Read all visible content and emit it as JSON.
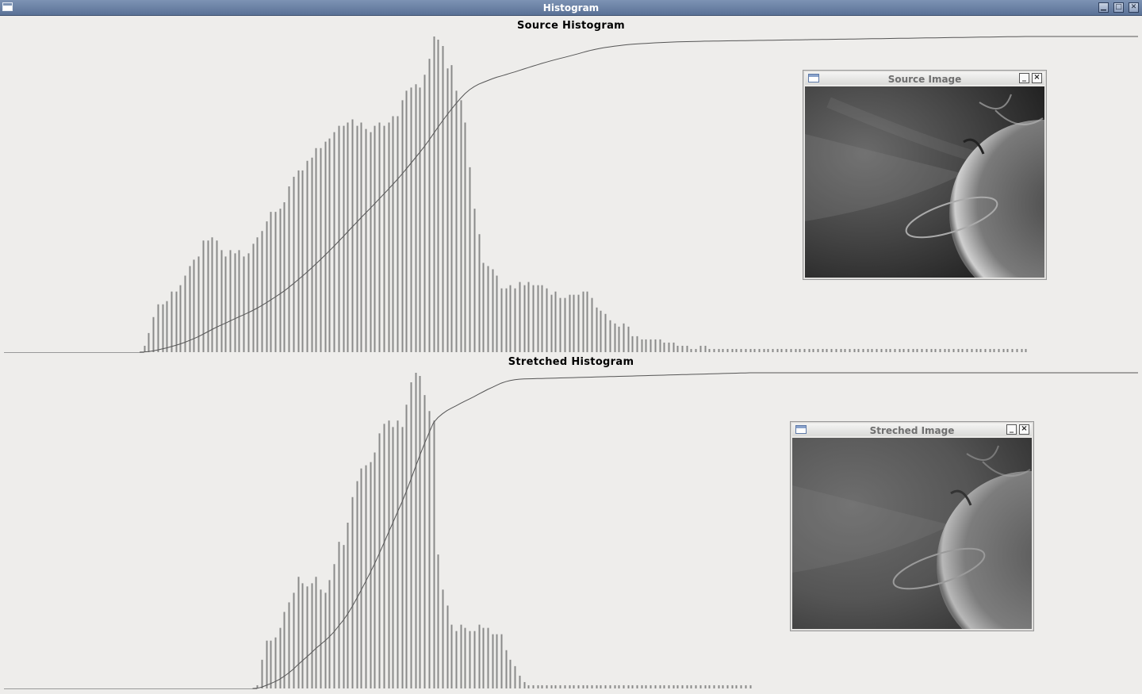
{
  "window": {
    "title": "Histogram"
  },
  "panels": [
    {
      "title": "Source Histogram"
    },
    {
      "title": "Stretched Histogram"
    }
  ],
  "source_image": {
    "title": "Source Image"
  },
  "stretched_image": {
    "title": "Streched Image"
  },
  "colors": {
    "bars": "#8a8a8a",
    "curve": "#555555",
    "background": "#eeedeb",
    "titlebar": "#6a81a6"
  },
  "chart_data": [
    {
      "type": "bar",
      "title": "Source Histogram",
      "x": [
        31,
        32,
        33,
        34,
        35,
        36,
        37,
        38,
        39,
        40,
        41,
        42,
        43,
        44,
        45,
        46,
        47,
        48,
        49,
        50,
        51,
        52,
        53,
        54,
        55,
        56,
        57,
        58,
        59,
        60,
        61,
        62,
        63,
        64,
        65,
        66,
        67,
        68,
        69,
        70,
        71,
        72,
        73,
        74,
        75,
        76,
        77,
        78,
        79,
        80,
        81,
        82,
        83,
        84,
        85,
        86,
        87,
        88,
        89,
        90,
        91,
        92,
        93,
        94,
        95,
        96,
        97,
        98,
        99,
        100,
        101,
        102,
        103,
        104,
        105,
        106,
        107,
        108,
        109,
        110,
        111,
        112,
        113,
        114,
        115,
        116,
        117,
        118,
        119,
        120,
        121,
        122,
        123,
        124,
        125,
        126,
        127,
        128,
        129,
        130,
        131,
        132,
        133,
        134,
        135,
        136,
        137,
        138,
        139,
        140,
        141,
        142,
        143,
        144,
        145,
        146,
        147,
        148,
        149,
        150,
        151,
        152,
        153,
        154,
        155,
        156,
        157,
        158,
        159,
        160,
        161,
        162,
        163,
        164,
        165,
        166,
        167,
        168,
        169,
        170,
        171,
        172,
        173,
        174,
        175,
        176,
        177,
        178,
        179,
        180,
        181,
        182,
        183,
        184,
        185,
        186,
        187,
        188,
        189,
        190,
        191,
        192,
        193,
        194,
        195,
        196,
        197,
        198,
        199,
        200,
        201,
        202,
        203,
        204,
        205,
        206,
        207,
        208,
        209,
        210,
        211,
        212,
        213,
        214,
        215,
        216,
        217,
        218,
        219,
        220,
        221,
        222,
        223,
        224,
        225,
        226
      ],
      "values": [
        2,
        6,
        11,
        15,
        15,
        16,
        19,
        19,
        21,
        24,
        27,
        29,
        30,
        35,
        35,
        36,
        35,
        32,
        30,
        32,
        31,
        32,
        30,
        31,
        34,
        36,
        38,
        41,
        44,
        44,
        45,
        47,
        52,
        55,
        57,
        57,
        60,
        61,
        64,
        64,
        66,
        67,
        69,
        71,
        71,
        72,
        73,
        71,
        72,
        70,
        69,
        71,
        72,
        71,
        72,
        74,
        74,
        79,
        82,
        83,
        84,
        83,
        87,
        92,
        99,
        98,
        96,
        89,
        90,
        82,
        79,
        72,
        58,
        45,
        37,
        28,
        27,
        26,
        24,
        20,
        20,
        21,
        20,
        22,
        21,
        22,
        21,
        21,
        21,
        20,
        18,
        19,
        17,
        17,
        18,
        18,
        18,
        19,
        19,
        17,
        14,
        13,
        12,
        10,
        9,
        8,
        9,
        8,
        5,
        5,
        4,
        4,
        4,
        4,
        4,
        3,
        3,
        3,
        2,
        2,
        2,
        1,
        1,
        2,
        2,
        1,
        1,
        1,
        1,
        1,
        1,
        1,
        1,
        1,
        1,
        1,
        1,
        1,
        1,
        1,
        1,
        1,
        1,
        1,
        1,
        1,
        1,
        1,
        1,
        1,
        1,
        1,
        1,
        1,
        1,
        1,
        1,
        1,
        1,
        1,
        1,
        1,
        1,
        1,
        1,
        1,
        1,
        1,
        1,
        1,
        1,
        1,
        1,
        1,
        1,
        1,
        1,
        1,
        1,
        1,
        1,
        1,
        1,
        1,
        1,
        1,
        1,
        1,
        1,
        1,
        1,
        1,
        1,
        1,
        1,
        1
      ],
      "cumulative_curve": true
    },
    {
      "type": "bar",
      "title": "Stretched Histogram",
      "x": [
        56,
        57,
        58,
        59,
        60,
        61,
        62,
        63,
        64,
        65,
        66,
        67,
        68,
        69,
        70,
        71,
        72,
        73,
        74,
        75,
        76,
        77,
        78,
        79,
        80,
        81,
        82,
        83,
        84,
        85,
        86,
        87,
        88,
        89,
        90,
        91,
        92,
        93,
        94,
        95,
        96,
        97,
        98,
        99,
        100,
        101,
        102,
        103,
        104,
        105,
        106,
        107,
        108,
        109,
        110,
        111,
        112,
        113,
        114,
        115,
        116,
        117,
        118,
        119,
        120,
        121,
        122,
        123,
        124,
        125,
        126,
        127,
        128,
        129,
        130,
        131,
        132,
        133,
        134,
        135,
        136,
        137,
        138,
        139,
        140,
        141,
        142,
        143,
        144,
        145,
        146,
        147,
        148,
        149,
        150,
        151,
        152,
        153,
        154,
        155,
        156,
        157,
        158,
        159,
        160,
        161,
        162,
        163,
        164,
        165
      ],
      "values": [
        1,
        9,
        15,
        15,
        16,
        19,
        24,
        27,
        30,
        35,
        33,
        32,
        33,
        35,
        31,
        30,
        34,
        39,
        46,
        45,
        52,
        60,
        65,
        69,
        70,
        71,
        74,
        80,
        83,
        84,
        82,
        84,
        82,
        89,
        96,
        99,
        98,
        92,
        87,
        84,
        42,
        31,
        26,
        20,
        18,
        20,
        19,
        18,
        18,
        20,
        19,
        19,
        17,
        17,
        17,
        12,
        9,
        7,
        4,
        2,
        1,
        1,
        1,
        1,
        1,
        1,
        1,
        1,
        1,
        1,
        1,
        1,
        1,
        1,
        1,
        1,
        1,
        1,
        1,
        1,
        1,
        1,
        1,
        1,
        1,
        1,
        1,
        1,
        1,
        1,
        1,
        1,
        1,
        1,
        1,
        1,
        1,
        1,
        1,
        1,
        1,
        1,
        1,
        1,
        1,
        1,
        1,
        1,
        1,
        1
      ],
      "cumulative_curve": true
    }
  ]
}
